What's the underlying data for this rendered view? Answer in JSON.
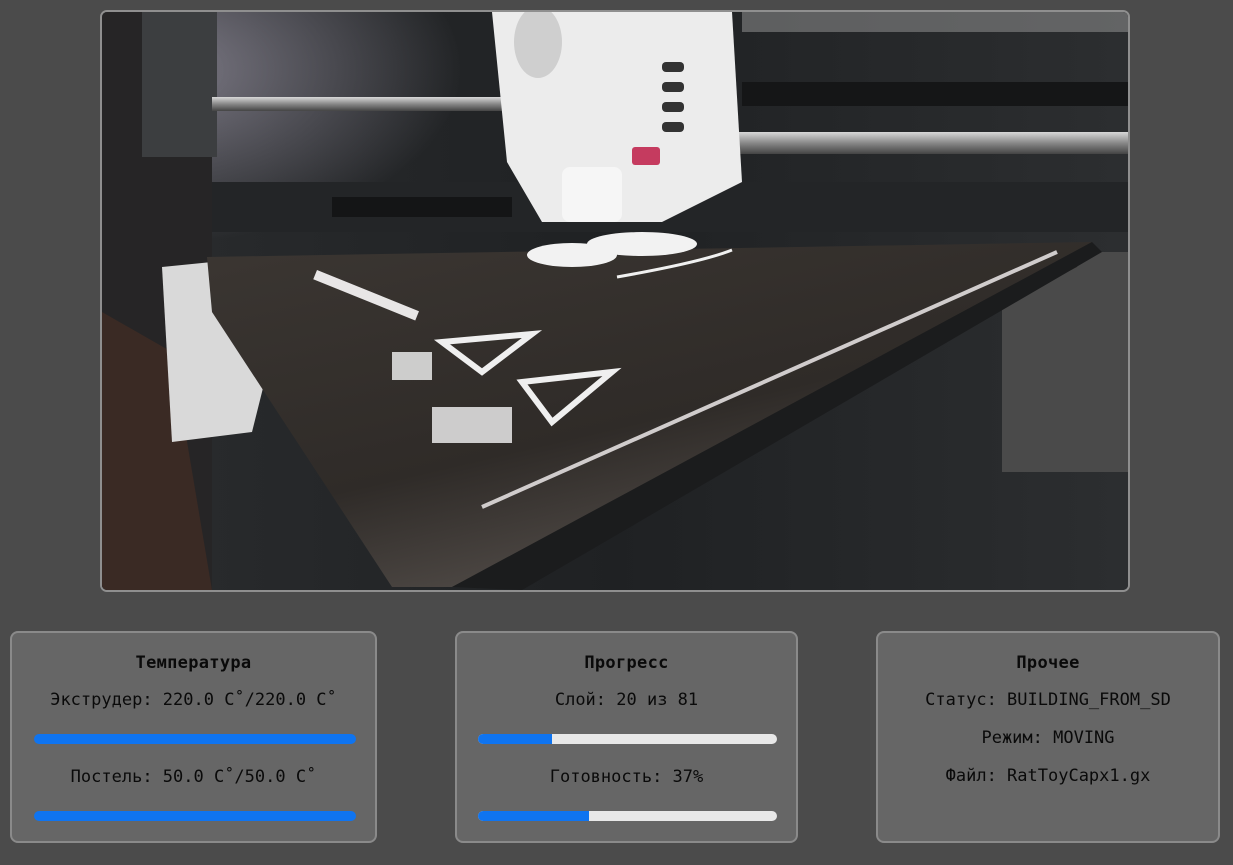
{
  "camera": {
    "description_icon": "camera-feed-image"
  },
  "temperature": {
    "title": "Температура",
    "extruder_label": "Экструдер: 220.0 C˚/220.0 C˚",
    "extruder_current": 220.0,
    "extruder_target": 220.0,
    "bed_label": "Постель: 50.0 C˚/50.0 C˚",
    "bed_current": 50.0,
    "bed_target": 50.0
  },
  "progress": {
    "title": "Прогресс",
    "layer_label": "Слой: 20 из 81",
    "layer_current": 20,
    "layer_total": 81,
    "done_label": "Готовность: 37%",
    "done_percent": 37
  },
  "other": {
    "title": "Прочее",
    "status_label": "Статус: BUILDING_FROM_SD",
    "mode_label": "Режим: MOVING",
    "file_label": "Файл: RatToyCapx1.gx"
  },
  "colors": {
    "bar_fill": "#0f74f0",
    "bar_track": "#e8e8e8",
    "card_bg": "#666666",
    "page_bg": "#4b4b4b"
  }
}
